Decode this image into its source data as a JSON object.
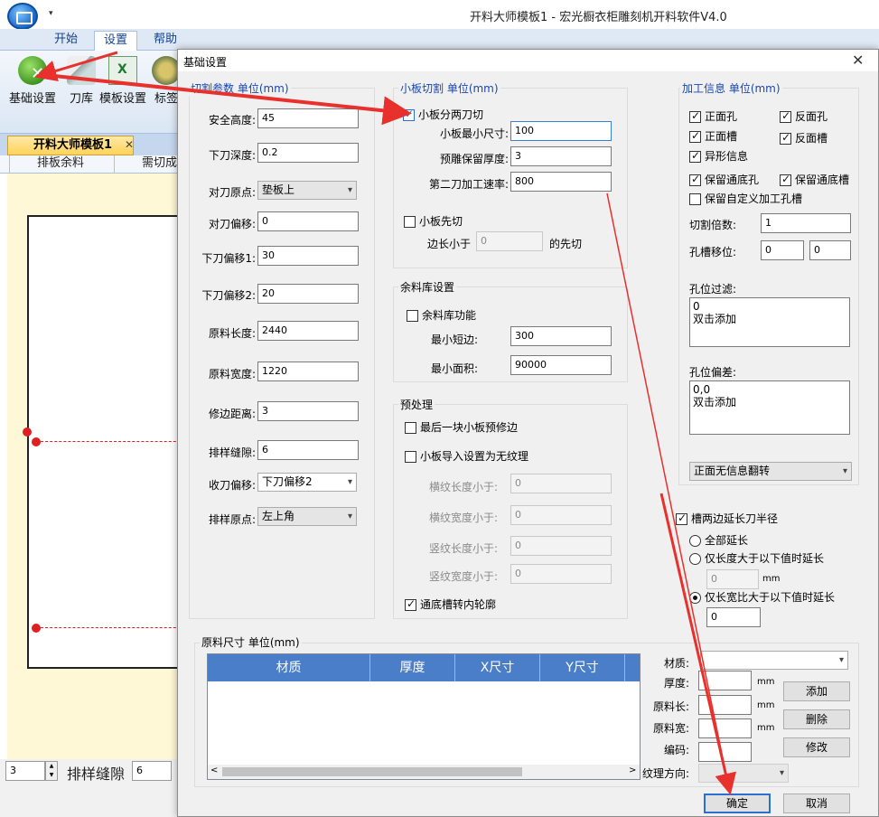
{
  "app": {
    "title": "开料大师模板1 - 宏光橱衣柜雕刻机开料软件V4.0",
    "qa_arrow": "▾",
    "ribbon_tabs": [
      "开始",
      "设置",
      "帮助"
    ],
    "ribbon_buttons": [
      "基础设置",
      "刀库",
      "模板设置",
      "标签"
    ],
    "doc_tab": "开料大师模板1",
    "doc_tab_close": "✕",
    "sub_tabs": [
      "排板余料",
      "需切成"
    ],
    "bottom": {
      "spin1_value": "3",
      "gap_label": "排样缝隙",
      "spin2_value": "6"
    }
  },
  "dialog": {
    "title": "基础设置",
    "close": "✕",
    "cut_params": {
      "title": "切割参数 单位(mm)",
      "fields": [
        {
          "label": "安全高度:",
          "value": "45"
        },
        {
          "label": "下刀深度:",
          "value": "0.2"
        },
        {
          "label": "对刀原点:",
          "value": "垫板上"
        },
        {
          "label": "对刀偏移:",
          "value": "0"
        },
        {
          "label": "下刀偏移1:",
          "value": "30"
        },
        {
          "label": "下刀偏移2:",
          "value": "20"
        },
        {
          "label": "原料长度:",
          "value": "2440"
        },
        {
          "label": "原料宽度:",
          "value": "1220"
        },
        {
          "label": "修边距离:",
          "value": "3"
        },
        {
          "label": "排样缝隙:",
          "value": "6"
        },
        {
          "label": "收刀偏移:",
          "value": "下刀偏移2"
        },
        {
          "label": "排样原点:",
          "value": "左上角"
        }
      ]
    },
    "small_cut": {
      "title": "小板切割 单位(mm)",
      "split_two": "小板分两刀切",
      "min_size_label": "小板最小尺寸:",
      "min_size_value": "100",
      "reserve_label": "预雕保留厚度:",
      "reserve_value": "3",
      "speed_label": "第二刀加工速率:",
      "speed_value": "800",
      "precut": "小板先切",
      "edge_prefix": "边长小于",
      "edge_value": "0",
      "edge_suffix": "的先切"
    },
    "remnant": {
      "title": "余料库设置",
      "enable": "余料库功能",
      "min_short_label": "最小短边:",
      "min_short_value": "300",
      "min_area_label": "最小面积:",
      "min_area_value": "90000"
    },
    "preprocess": {
      "title": "预处理",
      "last_trim": "最后一块小板预修边",
      "no_grain": "小板导入设置为无纹理",
      "h_len_label": "横纹长度小于:",
      "h_len_value": "0",
      "h_wid_label": "横纹宽度小于:",
      "h_wid_value": "0",
      "v_len_label": "竖纹长度小于:",
      "v_len_value": "0",
      "v_wid_label": "竖纹宽度小于:",
      "v_wid_value": "0",
      "slot_contour": "通底槽转内轮廓"
    },
    "machining": {
      "title": "加工信息 单位(mm)",
      "checks": [
        {
          "label": "正面孔",
          "checked": true
        },
        {
          "label": "反面孔",
          "checked": true
        },
        {
          "label": "正面槽",
          "checked": true
        },
        {
          "label": "反面槽",
          "checked": true
        },
        {
          "label": "异形信息",
          "checked": true
        },
        {
          "label": "保留通底孔",
          "checked": true
        },
        {
          "label": "保留通底槽",
          "checked": true
        },
        {
          "label": "保留自定义加工孔槽",
          "checked": false
        }
      ],
      "cut_times_label": "切割倍数:",
      "cut_times_value": "1",
      "hole_shift_label": "孔槽移位:",
      "hole_shift_x": "0",
      "hole_shift_y": "0",
      "hole_filter_label": "孔位过滤:",
      "hole_filter_text": "0\n双击添加",
      "hole_offset_label": "孔位偏差:",
      "hole_offset_text": "0,0\n双击添加",
      "flip_option": "正面无信息翻转"
    },
    "slot_extend": {
      "title": "槽两边延长刀半径",
      "opt_all": "全部延长",
      "opt_len": "仅长度大于以下值时延长",
      "len_value": "0",
      "unit": "mm",
      "opt_ratio": "仅长宽比大于以下值时延长",
      "ratio_value": "0"
    },
    "material": {
      "title": "原料尺寸 单位(mm)",
      "columns": [
        "材质",
        "厚度",
        "X尺寸",
        "Y尺寸"
      ],
      "rows": [],
      "scroll_left": "<",
      "scroll_right": ">",
      "material_label": "材质:",
      "material_value": "",
      "thickness_label": "厚度:",
      "length_label": "原料长:",
      "width_label": "原料宽:",
      "code_label": "编码:",
      "grain_label": "纹理方向:",
      "unit": "mm",
      "add": "添加",
      "delete": "删除",
      "modify": "修改"
    },
    "ok": "确定",
    "cancel": "取消"
  },
  "colors": {
    "annotation": "#e8302c",
    "accent": "#2b6fd4",
    "group_title_blue": "#1846b6",
    "table_header": "#4a7ec8"
  }
}
